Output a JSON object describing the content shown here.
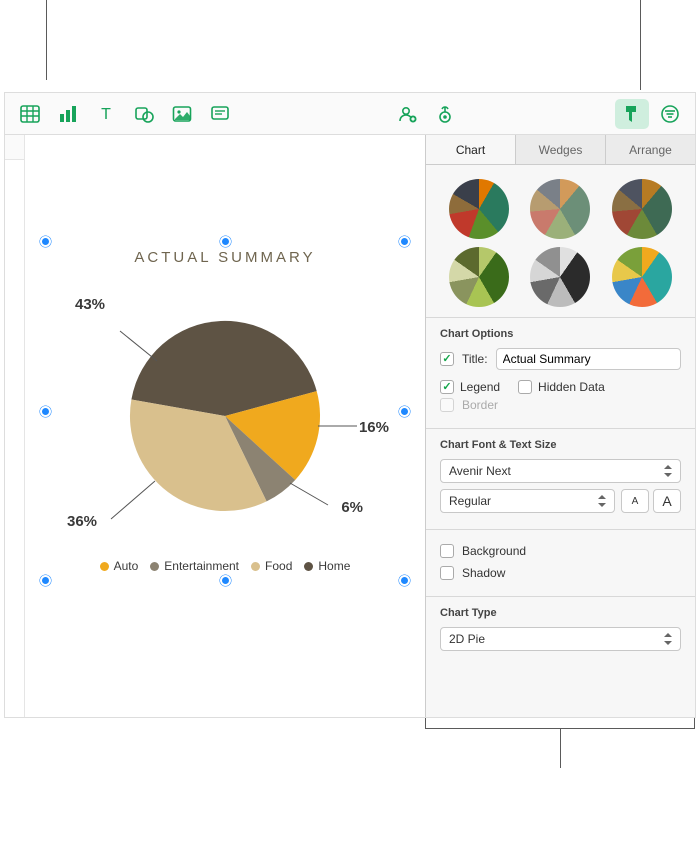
{
  "toolbar": {
    "icons": [
      "table",
      "chart",
      "text",
      "shape",
      "media",
      "comment",
      "collab",
      "settings",
      "format",
      "filter"
    ]
  },
  "inspector_tabs": {
    "chart": "Chart",
    "wedges": "Wedges",
    "arrange": "Arrange"
  },
  "chart_options": {
    "heading": "Chart Options",
    "title_label": "Title:",
    "title_value": "Actual Summary",
    "legend_label": "Legend",
    "hidden_data_label": "Hidden Data",
    "border_label": "Border"
  },
  "font_section": {
    "heading": "Chart Font & Text Size",
    "font_family": "Avenir Next",
    "font_weight": "Regular",
    "small_a": "A",
    "big_a": "A"
  },
  "background_label": "Background",
  "shadow_label": "Shadow",
  "chart_type": {
    "heading": "Chart Type",
    "value": "2D Pie"
  },
  "pie": {
    "title": "ACTUAL SUMMARY",
    "labels": {
      "home": "43%",
      "auto": "16%",
      "entertainment": "6%",
      "food": "36%"
    }
  },
  "legend": {
    "auto": "Auto",
    "entertainment": "Entertainment",
    "food": "Food",
    "home": "Home"
  },
  "colors": {
    "auto": "#f0a91e",
    "entertainment": "#8c8372",
    "food": "#d9c08d",
    "home": "#5e5344"
  },
  "chart_data": {
    "type": "pie",
    "title": "Actual Summary",
    "categories": [
      "Auto",
      "Entertainment",
      "Food",
      "Home"
    ],
    "values": [
      16,
      6,
      36,
      43
    ],
    "value_unit": "percent",
    "colors": [
      "#f0a91e",
      "#8c8372",
      "#d9c08d",
      "#5e5344"
    ],
    "legend_position": "bottom",
    "labels_shown": true
  }
}
